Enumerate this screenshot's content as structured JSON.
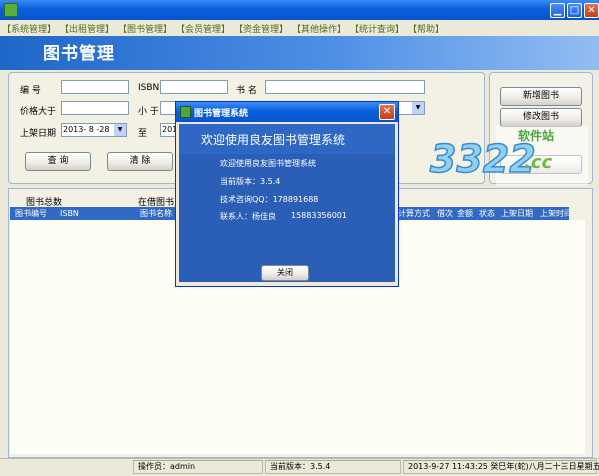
{
  "window": {
    "min_glyph": "▁",
    "max_glyph": "□",
    "close_glyph": "✕"
  },
  "menu": [
    "【系统管理】",
    "【出租管理】",
    "【图书管理】",
    "【会员管理】",
    "【资金管理】",
    "【其他操作】",
    "【统计查询】",
    "【帮助】"
  ],
  "header": {
    "title": "图书管理"
  },
  "search": {
    "no_label": "编  号",
    "isbn_label": "ISBN",
    "title_label": "书  名",
    "price_gt_label": "价格大于",
    "price_lt_label": "小  于",
    "date_label": "上架日期",
    "date_from": "2013- 8 -28",
    "to_label": "至",
    "date_to": "201",
    "query_button": "查  询",
    "clear_button": "清  除"
  },
  "actions": {
    "add_button": "新增图书",
    "edit_button": "修改图书"
  },
  "list": {
    "total_label": "图书总数",
    "lent_label": "在借图书"
  },
  "grid": {
    "columns": [
      "图书编号",
      "ISBN",
      "图书名称",
      "计算方式",
      "借次",
      "金额",
      "状态",
      "上架日期",
      "上架时间"
    ]
  },
  "status": {
    "operator": "操作员：admin",
    "version": "当前版本：3.5.4",
    "datetime": "2013-9-27 11:43:25 癸巳年(蛇)八月二十三日星期五"
  },
  "dialog": {
    "title": "图书管理系统",
    "heading": "欢迎使用良友图书管理系统",
    "welcome": "欢迎使用良友图书管理系统",
    "version": "当前版本：3.5.4",
    "qq": "技术咨询QQ：178891688",
    "contact_name": "联系人：杨佳良",
    "contact_phone": "15883356001",
    "close_button": "关闭",
    "close_glyph": "✕"
  },
  "watermark": {
    "number": "3322",
    "site": "软件站",
    ".cc": ".cc"
  }
}
